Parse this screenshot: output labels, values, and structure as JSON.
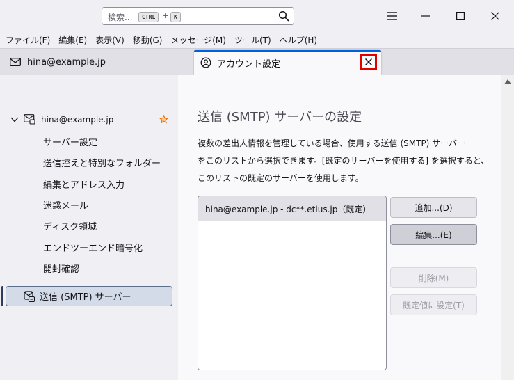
{
  "search": {
    "placeholder": "検索...",
    "key1": "CTRL",
    "plus": "+",
    "key2": "K"
  },
  "menubar": [
    "ファイル(F)",
    "編集(E)",
    "表示(V)",
    "移動(G)",
    "メッセージ(M)",
    "ツール(T)",
    "ヘルプ(H)"
  ],
  "tabs": {
    "mail": "hina@example.jp",
    "settings": "アカウント設定"
  },
  "sidebar": {
    "account": "hina@example.jp",
    "items": [
      "サーバー設定",
      "送信控えと特別なフォルダー",
      "編集とアドレス入力",
      "迷惑メール",
      "ディスク領域",
      "エンドツーエンド暗号化",
      "開封確認"
    ],
    "smtp": "送信 (SMTP) サーバー"
  },
  "main": {
    "heading": "送信 (SMTP) サーバーの設定",
    "desc": [
      "複数の差出人情報を管理している場合、使用する送信 (SMTP) サーバー",
      "をこのリストから選択できます。[既定のサーバーを使用する] を選択すると、",
      "このリストの既定のサーバーを使用します。"
    ],
    "server_entry": "hina@example.jp - dc**.etius.jp（既定）",
    "buttons": {
      "add": "追加...(D)",
      "edit": "編集...(E)",
      "delete": "削除(M)",
      "default": "既定値に設定(T)"
    }
  },
  "colors": {
    "accent": "#0061e0",
    "close_highlight": "#e00000",
    "star": "#e66a00"
  }
}
